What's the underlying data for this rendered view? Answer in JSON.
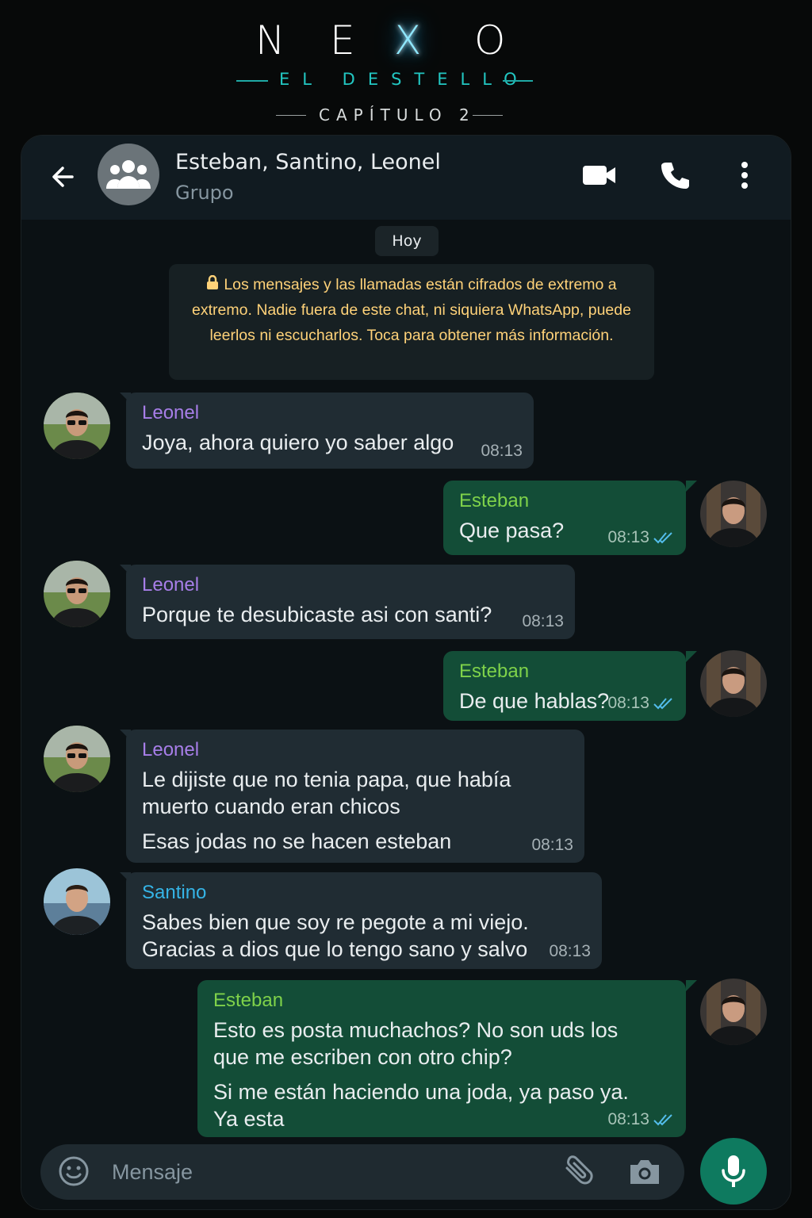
{
  "poster": {
    "brand_letters": [
      "N",
      "E",
      "X",
      "O"
    ],
    "subtitle": "EL DESTELLO",
    "chapter": "CAPÍTULO 2"
  },
  "header": {
    "title": "Esteban, Santino, Leonel",
    "subtitle": "Grupo",
    "back_icon": "arrow-left-icon",
    "avatar_icon": "group-icon",
    "actions": [
      "video-call-icon",
      "voice-call-icon",
      "more-vert-icon"
    ]
  },
  "chat": {
    "day_label": "Hoy",
    "encryption_notice": "Los mensajes y las llamadas están cifrados de extremo a extremo. Nadie fuera de este chat, ni siquiera WhatsApp, puede leerlos ni escucharlos. Toca para obtener más información.",
    "messages": [
      {
        "sender": "Leonel",
        "direction": "in",
        "lines": [
          "Joya, ahora quiero yo saber algo"
        ],
        "time": "08:13"
      },
      {
        "sender": "Esteban",
        "direction": "out",
        "lines": [
          "Que pasa?"
        ],
        "time": "08:13",
        "read": true
      },
      {
        "sender": "Leonel",
        "direction": "in",
        "lines": [
          "Porque te desubicaste asi con santi?"
        ],
        "time": "08:13"
      },
      {
        "sender": "Esteban",
        "direction": "out",
        "lines": [
          "De que hablas?"
        ],
        "time": "08:13",
        "read": true
      },
      {
        "sender": "Leonel",
        "direction": "in",
        "lines": [
          "Le dijiste que no tenia papa, que había",
          "muerto cuando eran chicos",
          "Esas jodas no se hacen esteban"
        ],
        "time": "08:13"
      },
      {
        "sender": "Santino",
        "direction": "in",
        "lines": [
          "Sabes bien que soy re pegote a mi viejo.",
          "Gracias a dios que lo tengo sano y salvo"
        ],
        "time": "08:13"
      },
      {
        "sender": "Esteban",
        "direction": "out",
        "lines": [
          "Esto es posta muchachos? No son uds los",
          "que me escriben con otro chip?",
          "Si me están haciendo una joda, ya paso ya.",
          "Ya esta"
        ],
        "time": "08:13",
        "read": true
      }
    ]
  },
  "composer": {
    "placeholder": "Mensaje",
    "icons": [
      "emoji-icon",
      "attach-icon",
      "camera-icon",
      "mic-icon"
    ]
  },
  "colors": {
    "leonel": "#a77ee8",
    "santino": "#35b4e6",
    "esteban": "#7fd24a",
    "accent": "#0e7a5f",
    "notice": "#ffd279",
    "ticks": "#53bdeb"
  }
}
